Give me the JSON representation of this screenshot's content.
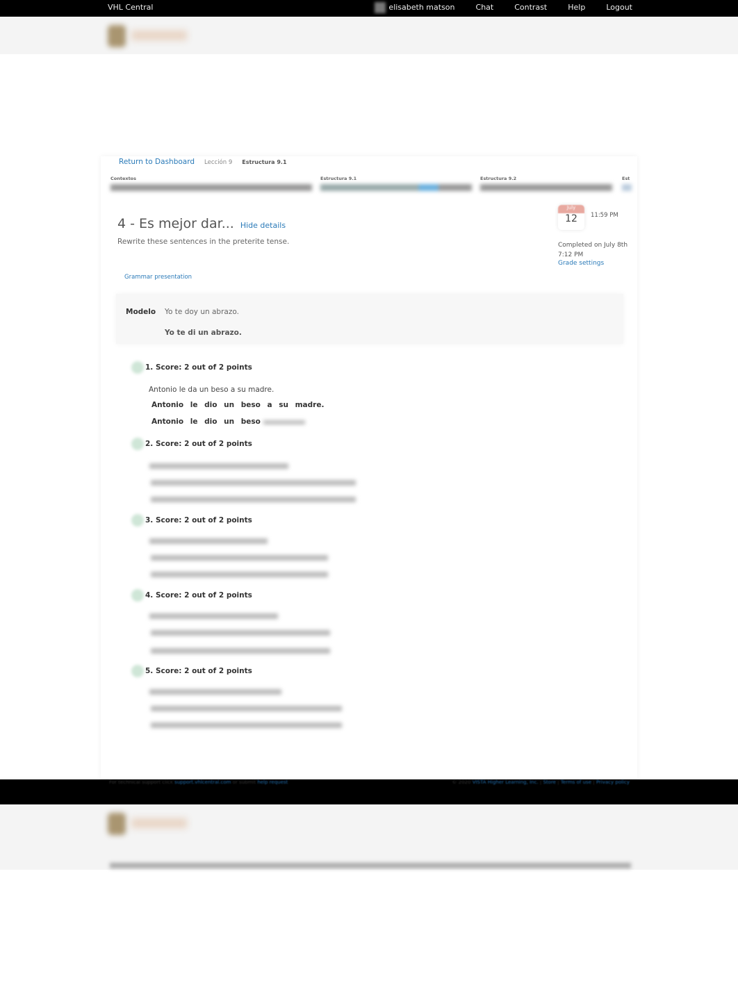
{
  "topbar": {
    "brand": "VHL Central",
    "user": "elisabeth matson",
    "chat": "Chat",
    "contrast": "Contrast",
    "help": "Help",
    "logout": "Logout"
  },
  "breadcrumb": {
    "return": "Return to Dashboard",
    "lesson": "Lección 9",
    "current": "Estructura 9.1"
  },
  "sections": [
    "Contextos",
    "Estructura 9.1",
    "Estructura 9.2",
    "Est"
  ],
  "activity": {
    "title": "4 - Es mejor dar...",
    "hide_details": "Hide details",
    "instructions": "Rewrite these sentences in the preterite tense.",
    "grammar_link": "Grammar presentation"
  },
  "due": {
    "month": "July",
    "day": "12",
    "time": "11:59 PM",
    "completed": "Completed on July 8th 7:12 PM",
    "grade_settings": "Grade settings"
  },
  "modelo": {
    "label": "Modelo",
    "question": "Yo te doy un abrazo.",
    "answer": "Yo te di un abrazo."
  },
  "items": [
    {
      "score": "1.  Score: 2 out of 2 points",
      "prompt": "Antonio le da un beso a su madre.",
      "answer": "Antonio le dio un beso a su madre.",
      "answer2": "Antonio le dio un beso"
    },
    {
      "score": "2.  Score: 2 out of 2 points"
    },
    {
      "score": "3.  Score: 2 out of 2 points"
    },
    {
      "score": "4.  Score: 2 out of 2 points"
    },
    {
      "score": "5.  Score: 2 out of 2 points"
    }
  ],
  "footer": {
    "support_text": "For technical support click",
    "support_link": "support.vhlcentral.com",
    "or_submit": "or submit",
    "help_request": "help request",
    "copyright": "© 2020",
    "company": "VISTA Higher Learning, Inc.",
    "store": "Store",
    "terms": "Terms of use",
    "privacy": "Privacy policy"
  }
}
